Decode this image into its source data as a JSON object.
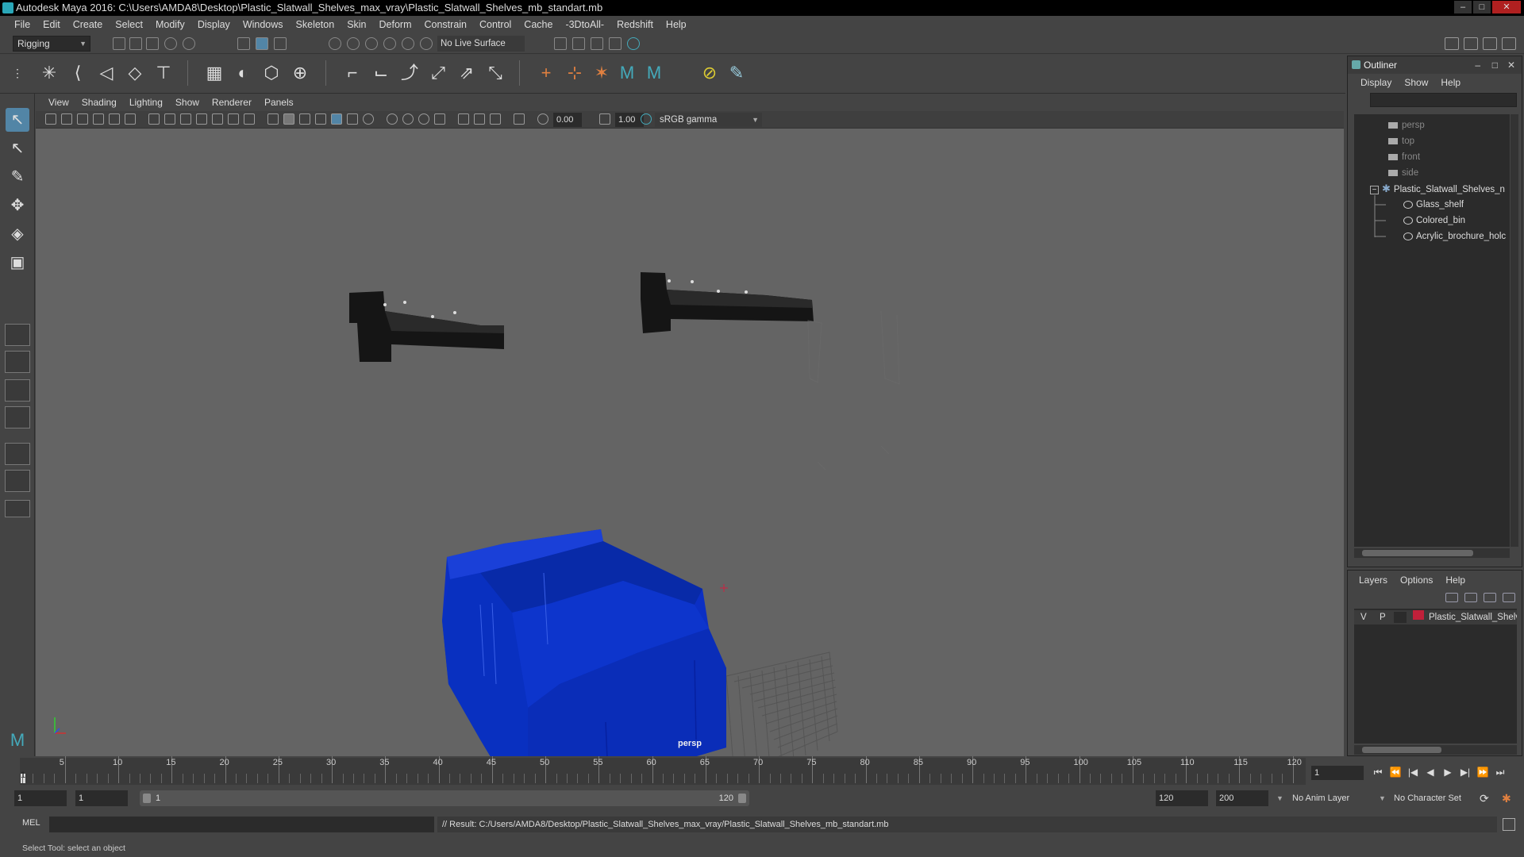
{
  "window": {
    "title": "Autodesk Maya 2016: C:\\Users\\AMDA8\\Desktop\\Plastic_Slatwall_Shelves_max_vray\\Plastic_Slatwall_Shelves_mb_standart.mb",
    "controls": {
      "minimize": "–",
      "maximize": "□",
      "close": "✕"
    }
  },
  "menubar": [
    "File",
    "Edit",
    "Create",
    "Select",
    "Modify",
    "Display",
    "Windows",
    "Skeleton",
    "Skin",
    "Deform",
    "Constrain",
    "Control",
    "Cache",
    "-3DtoAll-",
    "Redshift",
    "Help"
  ],
  "statusline": {
    "mode": "Rigging",
    "live_surface": "No Live Surface"
  },
  "viewport": {
    "menu": [
      "View",
      "Shading",
      "Lighting",
      "Show",
      "Renderer",
      "Panels"
    ],
    "exposure": "0.00",
    "gamma": "1.00",
    "color_space": "sRGB gamma",
    "camera": "persp"
  },
  "outliner": {
    "title": "Outliner",
    "menu": [
      "Display",
      "Show",
      "Help"
    ],
    "items": [
      {
        "label": "persp",
        "kind": "camera"
      },
      {
        "label": "top",
        "kind": "camera"
      },
      {
        "label": "front",
        "kind": "camera"
      },
      {
        "label": "side",
        "kind": "camera"
      },
      {
        "label": "Plastic_Slatwall_Shelves_n",
        "kind": "set",
        "expanded": true
      },
      {
        "label": "Glass_shelf",
        "kind": "mesh"
      },
      {
        "label": "Colored_bin",
        "kind": "mesh"
      },
      {
        "label": "Acrylic_brochure_holc",
        "kind": "mesh"
      }
    ]
  },
  "layers": {
    "menu": [
      "Layers",
      "Options",
      "Help"
    ],
    "rows": [
      {
        "v": "V",
        "p": "P",
        "name": "Plastic_Slatwall_Shelve",
        "color": "#c0203a"
      }
    ]
  },
  "timeslider": {
    "ticks": [
      "5",
      "10",
      "15",
      "20",
      "25",
      "30",
      "35",
      "40",
      "45",
      "50",
      "55",
      "60",
      "65",
      "70",
      "75",
      "80",
      "85",
      "90",
      "95",
      "100",
      "105",
      "110",
      "115",
      "120"
    ],
    "current_frame": "1",
    "current_frame_field": "1"
  },
  "rangeslider": {
    "start": "1",
    "playback_start": "1",
    "range_start_label": "1",
    "range_end_label": "120",
    "playback_end": "120",
    "end": "200",
    "anim_layer": "No Anim Layer",
    "character_set": "No Character Set"
  },
  "cmdline": {
    "language": "MEL",
    "result": "// Result: C:/Users/AMDA8/Desktop/Plastic_Slatwall_Shelves_max_vray/Plastic_Slatwall_Shelves_mb_standart.mb"
  },
  "helpline": "Select Tool: select an object",
  "colors": {
    "bin": "#0b2fc4",
    "bracket": "#151515",
    "viewport_bg": "#646464",
    "panel_bg": "#444444",
    "active_tool": "#5285a6"
  }
}
